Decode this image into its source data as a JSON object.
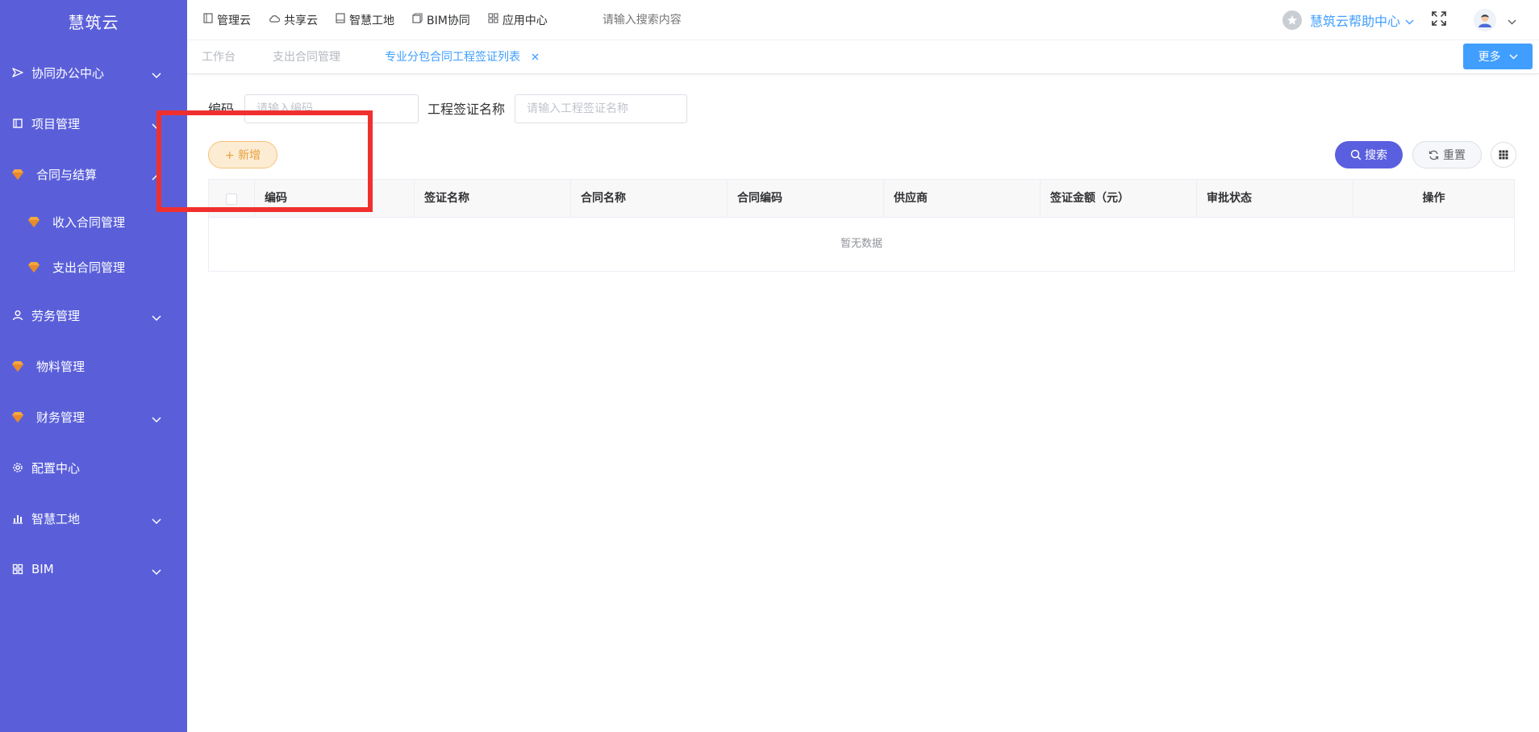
{
  "sidebar": {
    "brand": "慧筑云",
    "items": [
      {
        "label": "协同办公中心"
      },
      {
        "label": "项目管理"
      },
      {
        "label": "合同与结算"
      },
      {
        "label": "收入合同管理"
      },
      {
        "label": "支出合同管理"
      },
      {
        "label": "劳务管理"
      },
      {
        "label": "物料管理"
      },
      {
        "label": "财务管理"
      },
      {
        "label": "配置中心"
      },
      {
        "label": "智慧工地"
      },
      {
        "label": "BIM"
      }
    ]
  },
  "topnav": {
    "items": [
      {
        "label": "管理云",
        "icon": "document-icon"
      },
      {
        "label": "共享云",
        "icon": "cloud-icon"
      },
      {
        "label": "智慧工地",
        "icon": "book-icon"
      },
      {
        "label": "BIM协同",
        "icon": "cube-icon"
      },
      {
        "label": "应用中心",
        "icon": "apps-icon"
      }
    ],
    "search_placeholder": "请输入搜索内容",
    "help_label": "慧筑云帮助中心"
  },
  "tabs": [
    {
      "label": "工作台"
    },
    {
      "label": "支出合同管理"
    },
    {
      "label": "专业分包合同工程签证列表"
    }
  ],
  "more_label": "更多",
  "filters": {
    "code_label": "编码",
    "code_placeholder": "请输入编码",
    "name_label": "工程签证名称",
    "name_placeholder": "请输入工程签证名称"
  },
  "buttons": {
    "add": "+ 新增",
    "search": "搜索",
    "reset": "重置"
  },
  "table": {
    "columns": [
      "编码",
      "签证名称",
      "合同名称",
      "合同编码",
      "供应商",
      "签证金额（元）",
      "审批状态",
      "操作"
    ],
    "empty_text": "暂无数据"
  },
  "colors": {
    "sidebar": "#5a5fd9",
    "primary": "#409eff",
    "search_button": "#5a5fe0",
    "add_button": "#fdecd4",
    "highlight_box": "#f0302f"
  }
}
